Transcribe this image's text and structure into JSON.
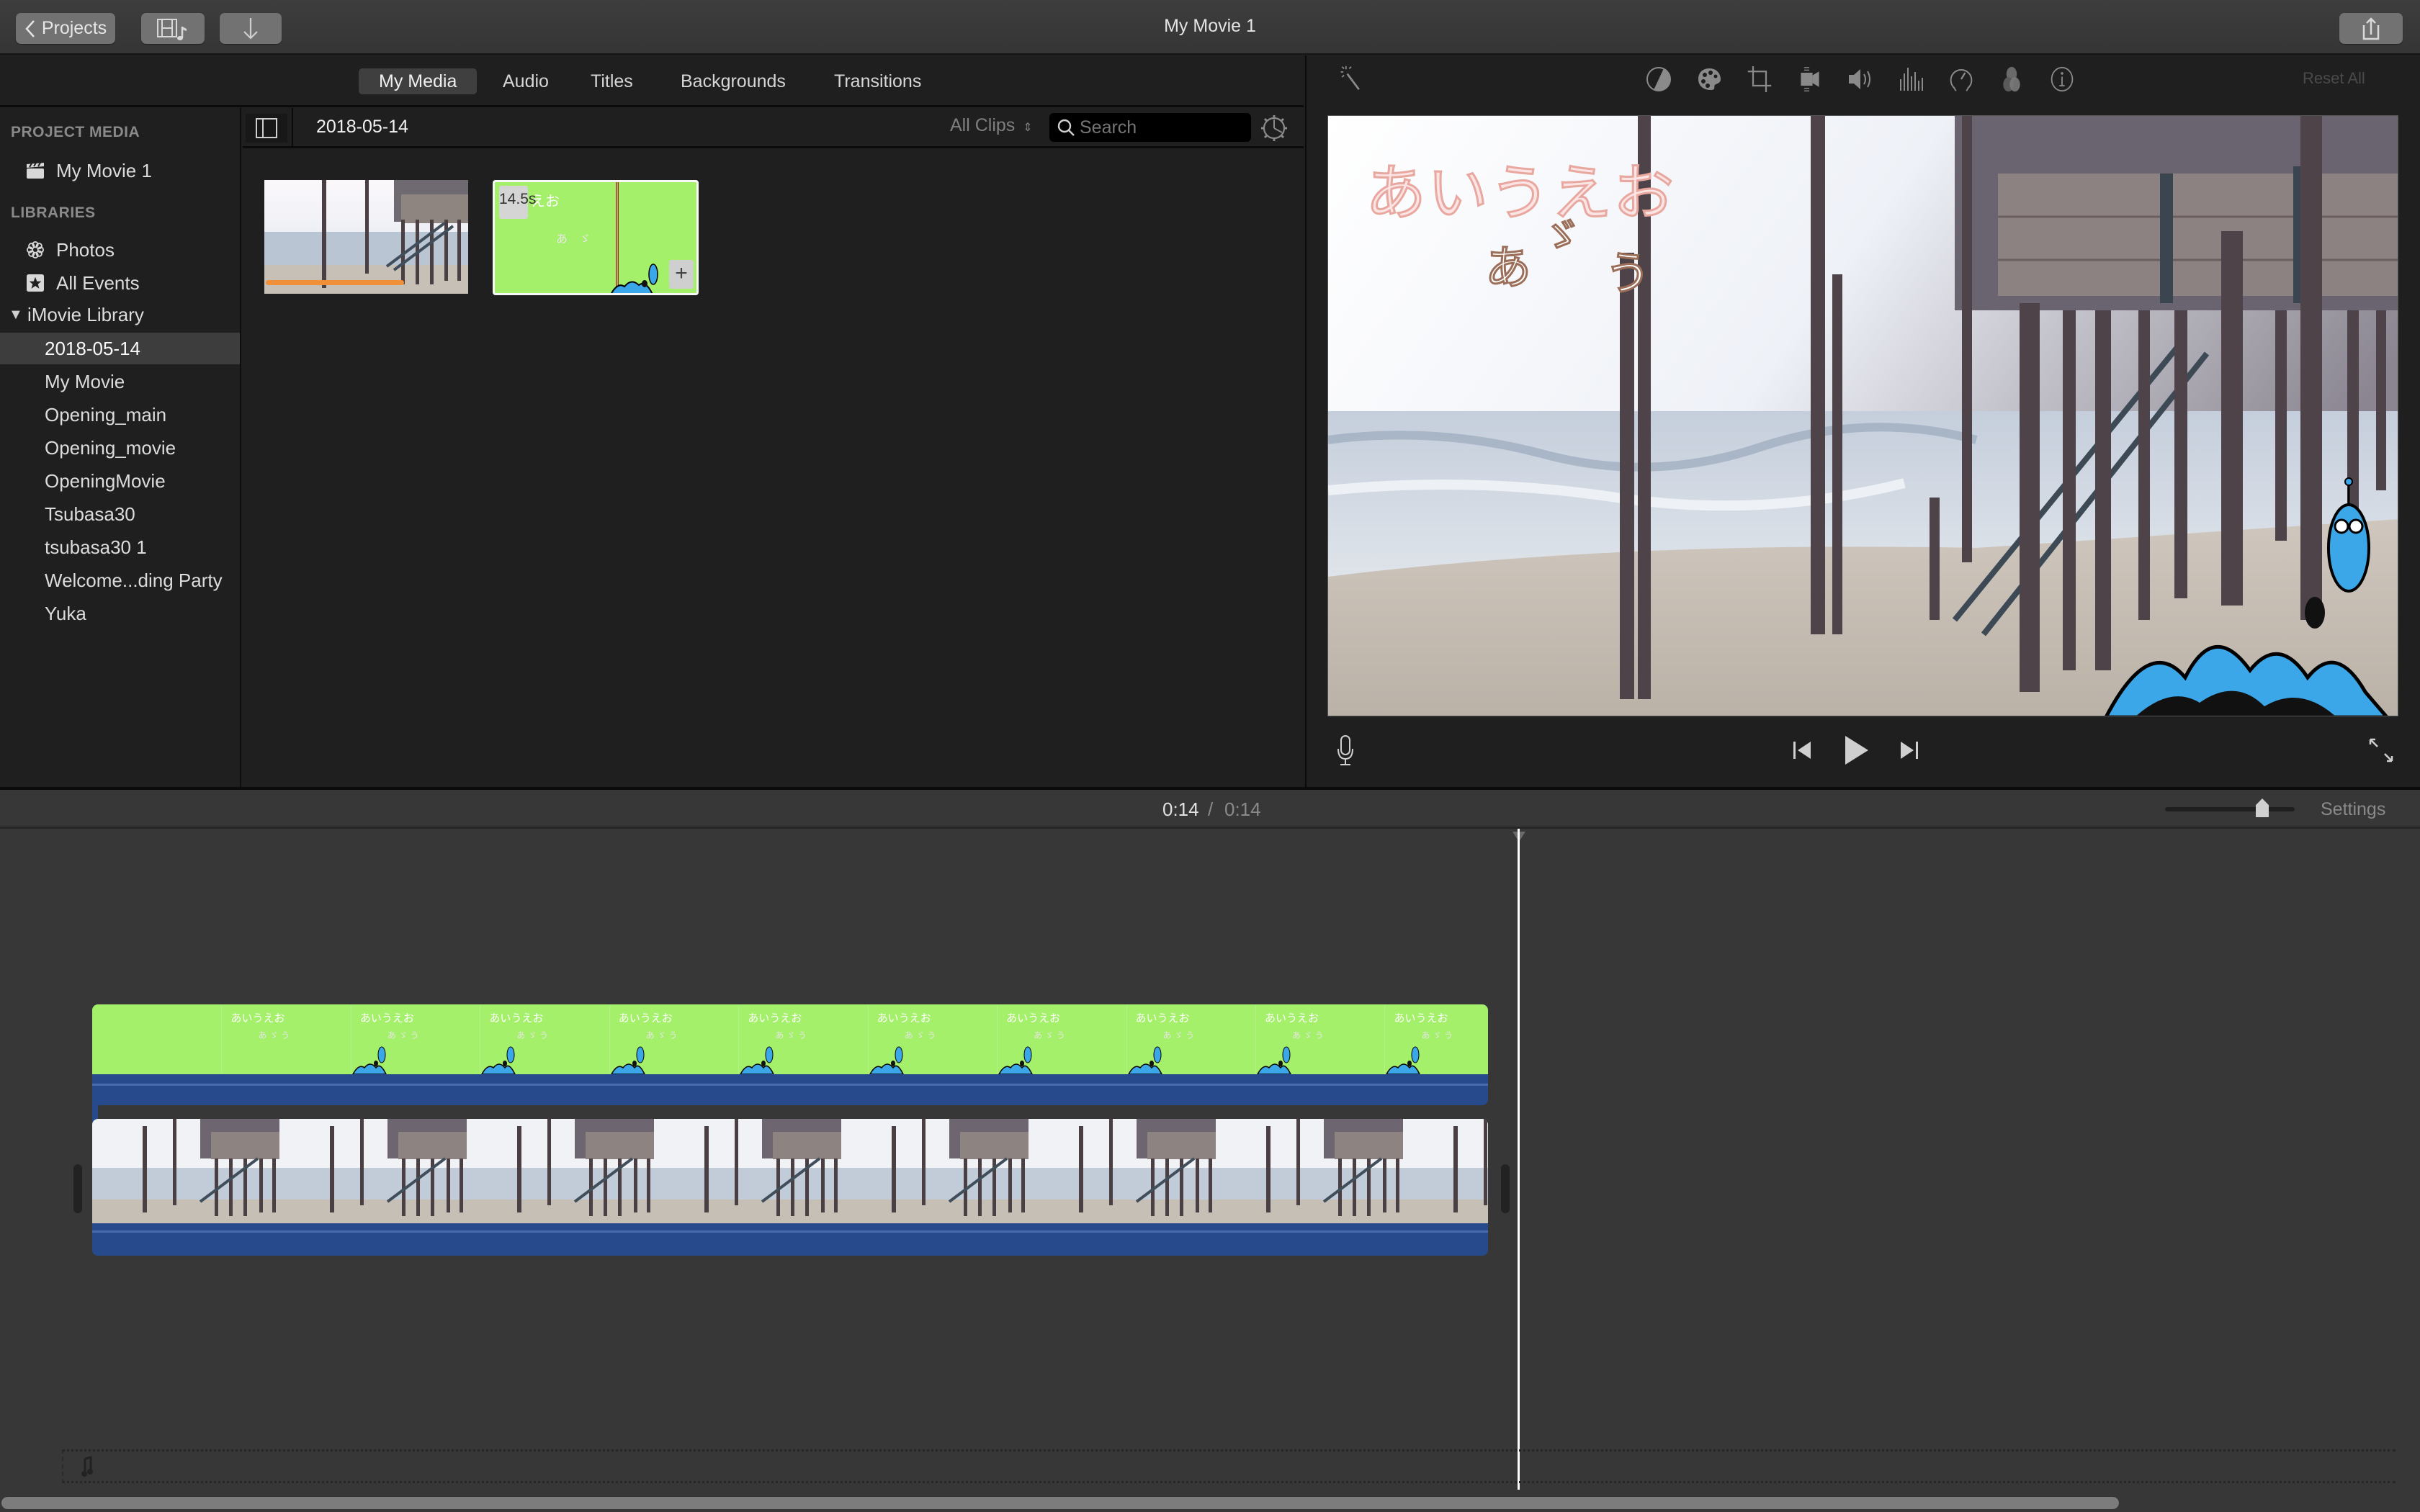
{
  "window": {
    "title": "My Movie 1",
    "projects_button": "Projects",
    "media_toggle_icon": "film-music-icon",
    "import_icon": "download-arrow-icon",
    "share_icon": "share-icon"
  },
  "tabs": [
    {
      "label": "My Media",
      "active": true
    },
    {
      "label": "Audio",
      "active": false
    },
    {
      "label": "Titles",
      "active": false
    },
    {
      "label": "Backgrounds",
      "active": false
    },
    {
      "label": "Transitions",
      "active": false
    }
  ],
  "sidebar": {
    "project_media_heading": "PROJECT MEDIA",
    "project_item": "My Movie 1",
    "libraries_heading": "LIBRARIES",
    "photos": "Photos",
    "all_events": "All Events",
    "library_name": "iMovie Library",
    "events": [
      {
        "label": "2018-05-14",
        "selected": true
      },
      {
        "label": "My Movie",
        "selected": false
      },
      {
        "label": "Opening_main",
        "selected": false
      },
      {
        "label": "Opening_movie",
        "selected": false
      },
      {
        "label": "OpeningMovie",
        "selected": false
      },
      {
        "label": "Tsubasa30",
        "selected": false
      },
      {
        "label": "tsubasa30 1",
        "selected": false
      },
      {
        "label": "Welcome...ding Party",
        "selected": false
      },
      {
        "label": "Yuka",
        "selected": false
      }
    ]
  },
  "browser": {
    "event_title": "2018-05-14",
    "filter": "All Clips",
    "search_placeholder": "Search",
    "clips": [
      {
        "name": "beach-clip",
        "used_in_project": true
      },
      {
        "name": "title-clip",
        "duration": "14.5s",
        "add_label": "+"
      }
    ]
  },
  "viewer": {
    "toolbar_icons": [
      "magic-wand-icon",
      "color-balance-icon",
      "color-correction-icon",
      "crop-icon",
      "stabilization-icon",
      "volume-icon",
      "noise-reduction-icon",
      "speed-icon",
      "clip-filter-icon",
      "info-icon"
    ],
    "reset_all": "Reset All",
    "overlay_title": "あいうえお",
    "overlay_chars": [
      "あ",
      "ゞ",
      "う"
    ]
  },
  "timeline": {
    "current_time": "0:14",
    "separator": "/",
    "total_time": "0:14",
    "settings_label": "Settings",
    "zoom_level": 0.75,
    "title_frame_text": "あいうえお",
    "title_frames": 11,
    "video_frames": 8
  },
  "colors": {
    "green_screen": "#a4f06a",
    "audio_blue": "#264a8c",
    "used_bar": "#f0913a"
  }
}
